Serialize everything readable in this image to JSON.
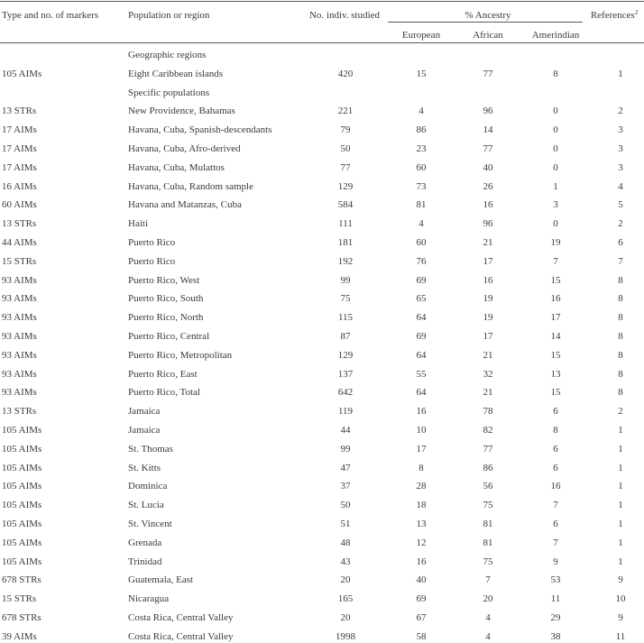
{
  "table": {
    "headers": {
      "type": "Type and no. of markers",
      "population": "Population or region",
      "n": "No. indiv. studied",
      "ancestry_group": "% Ancestry",
      "european": "European",
      "african": "African",
      "amerindian": "Amerindian",
      "references": "References",
      "references_sup": "2"
    },
    "rows": [
      {
        "type": "",
        "population": "Geographic regions",
        "n": "",
        "eu": "",
        "af": "",
        "am": "",
        "ref": ""
      },
      {
        "type": "105 AIMs",
        "population": "Eight Caribbean islands",
        "n": "420",
        "eu": "15",
        "af": "77",
        "am": "8",
        "ref": "1"
      },
      {
        "type": "",
        "population": "Specific populations",
        "n": "",
        "eu": "",
        "af": "",
        "am": "",
        "ref": ""
      },
      {
        "type": "13 STRs",
        "population": "New Providence, Bahamas",
        "n": "221",
        "eu": "4",
        "af": "96",
        "am": "0",
        "ref": "2"
      },
      {
        "type": "17 AIMs",
        "population": "Havana, Cuba, Spanish-descendants",
        "n": "79",
        "eu": "86",
        "af": "14",
        "am": "0",
        "ref": "3"
      },
      {
        "type": "17 AIMs",
        "population": "Havana, Cuba, Afro-derived",
        "n": "50",
        "eu": "23",
        "af": "77",
        "am": "0",
        "ref": "3"
      },
      {
        "type": "17 AIMs",
        "population": "Havana, Cuba, Mulattos",
        "n": "77",
        "eu": "60",
        "af": "40",
        "am": "0",
        "ref": "3"
      },
      {
        "type": "16 AIMs",
        "population": "Havana, Cuba, Random sample",
        "n": "129",
        "eu": "73",
        "af": "26",
        "am": "1",
        "ref": "4"
      },
      {
        "type": "60 AIMs",
        "population": "Havana and Matanzas, Cuba",
        "n": "584",
        "eu": "81",
        "af": "16",
        "am": "3",
        "ref": "5"
      },
      {
        "type": "13 STRs",
        "population": "Haiti",
        "n": "111",
        "eu": "4",
        "af": "96",
        "am": "0",
        "ref": "2"
      },
      {
        "type": "44 AIMs",
        "population": "Puerto Rico",
        "n": "181",
        "eu": "60",
        "af": "21",
        "am": "19",
        "ref": "6"
      },
      {
        "type": "15 STRs",
        "population": "Puerto Rico",
        "n": "192",
        "eu": "76",
        "af": "17",
        "am": "7",
        "ref": "7"
      },
      {
        "type": "93 AIMs",
        "population": "Puerto Rico, West",
        "n": "99",
        "eu": "69",
        "af": "16",
        "am": "15",
        "ref": "8"
      },
      {
        "type": "93 AIMs",
        "population": "Puerto Rico, South",
        "n": "75",
        "eu": "65",
        "af": "19",
        "am": "16",
        "ref": "8"
      },
      {
        "type": "93 AIMs",
        "population": "Puerto Rico, North",
        "n": "115",
        "eu": "64",
        "af": "19",
        "am": "17",
        "ref": "8"
      },
      {
        "type": "93 AIMs",
        "population": "Puerto Rico, Central",
        "n": "87",
        "eu": "69",
        "af": "17",
        "am": "14",
        "ref": "8"
      },
      {
        "type": "93 AIMs",
        "population": "Puerto Rico, Metropolitan",
        "n": "129",
        "eu": "64",
        "af": "21",
        "am": "15",
        "ref": "8"
      },
      {
        "type": "93 AIMs",
        "population": "Puerto Rico, East",
        "n": "137",
        "eu": "55",
        "af": "32",
        "am": "13",
        "ref": "8"
      },
      {
        "type": "93 AIMs",
        "population": "Puerto Rico, Total",
        "n": "642",
        "eu": "64",
        "af": "21",
        "am": "15",
        "ref": "8"
      },
      {
        "type": "13 STRs",
        "population": "Jamaica",
        "n": "119",
        "eu": "16",
        "af": "78",
        "am": "6",
        "ref": "2"
      },
      {
        "type": "105 AIMs",
        "population": "Jamaica",
        "n": "44",
        "eu": "10",
        "af": "82",
        "am": "8",
        "ref": "1"
      },
      {
        "type": "105 AIMs",
        "population": "St. Thomas",
        "n": "99",
        "eu": "17",
        "af": "77",
        "am": "6",
        "ref": "1"
      },
      {
        "type": "105 AIMs",
        "population": "St. Kitts",
        "n": "47",
        "eu": "8",
        "af": "86",
        "am": "6",
        "ref": "1"
      },
      {
        "type": "105 AIMs",
        "population": "Dominica",
        "n": "37",
        "eu": "28",
        "af": "56",
        "am": "16",
        "ref": "1"
      },
      {
        "type": "105 AIMs",
        "population": "St. Lucia",
        "n": "50",
        "eu": "18",
        "af": "75",
        "am": "7",
        "ref": "1"
      },
      {
        "type": "105 AIMs",
        "population": "St. Vincent",
        "n": "51",
        "eu": "13",
        "af": "81",
        "am": "6",
        "ref": "1"
      },
      {
        "type": "105 AIMs",
        "population": "Grenada",
        "n": "48",
        "eu": "12",
        "af": "81",
        "am": "7",
        "ref": "1"
      },
      {
        "type": "105 AIMs",
        "population": "Trinidad",
        "n": "43",
        "eu": "16",
        "af": "75",
        "am": "9",
        "ref": "1"
      },
      {
        "type": "678 STRs",
        "population": "Guatemala, East",
        "n": "20",
        "eu": "40",
        "af": "7",
        "am": "53",
        "ref": "9"
      },
      {
        "type": "15 STRs",
        "population": "Nicaragua",
        "n": "165",
        "eu": "69",
        "af": "20",
        "am": "11",
        "ref": "10"
      },
      {
        "type": "678 STRs",
        "population": "Costa Rica, Central Valley",
        "n": "20",
        "eu": "67",
        "af": "4",
        "am": "29",
        "ref": "9"
      },
      {
        "type": "39 AIMs",
        "population": "Costa Rica, Central Valley",
        "n": "1998",
        "eu": "58",
        "af": "4",
        "am": "38",
        "ref": "11"
      }
    ]
  }
}
